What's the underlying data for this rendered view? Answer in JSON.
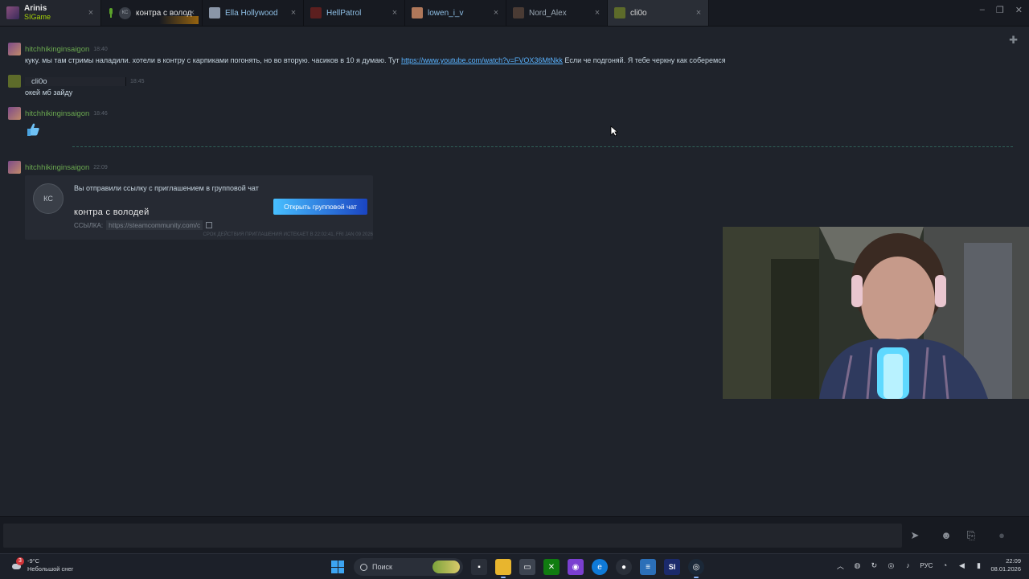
{
  "tabs": {
    "self": {
      "name": "Arinis",
      "game": "SIGame"
    },
    "items": [
      {
        "label": "контра с волод",
        "kind": "group",
        "initials": "КС"
      },
      {
        "label": "Ella Hollywood",
        "color": "#8a96a8"
      },
      {
        "label": "HellPatrol",
        "color": "#5c1f1f"
      },
      {
        "label": "lowen_i_v",
        "color": "#b0785a"
      },
      {
        "label": "Nord_Alex",
        "color": "#4a3b34"
      },
      {
        "label": "cli0o",
        "color": "#5d6b2a"
      }
    ],
    "close_glyph": "×"
  },
  "window_controls": {
    "minimize": "–",
    "maximize": "❐",
    "close": "✕"
  },
  "chat": {
    "messages": [
      {
        "author": "hitchhikinginsaigon",
        "time": "18:40",
        "text_before": "куку. мы там стримы наладили. хотели в контру с карпиками погонять, но во вторую. часиков в 10 я думаю. Тут ",
        "link": "https://www.youtube.com/watch?v=FVOX36MtNkk",
        "text_after": " Если че подгоняй. Я тебе черкну как соберемся"
      },
      {
        "author": "cli0o",
        "time": "18:45",
        "text": "окей мб зайду"
      },
      {
        "author": "hitchhikinginsaigon",
        "time": "18:46",
        "emoji": "thumbs-up"
      },
      {
        "author": "hitchhikinginsaigon",
        "time": "22:09"
      }
    ],
    "invite": {
      "initials": "КС",
      "text": "Вы отправили ссылку с приглашением в групповой чат",
      "group_name": "контра с володей",
      "link_label": "ССЫЛКА:",
      "link_value": "https://steamcommunity.com/c",
      "button": "Открыть групповой чат",
      "expires": "СРОК ДЕЙСТВИЯ ПРИГЛАШЕНИЯ ИСТЕКАЕТ В 22:02:41, FRI JAN 09 2026"
    }
  },
  "input": {
    "placeholder": "",
    "send_icon": "send-icon"
  },
  "taskbar": {
    "weather": {
      "temp": "-9°C",
      "desc": "Небольшой снег",
      "badge": "3"
    },
    "search_label": "Поиск",
    "tray": {
      "lang": "РУС",
      "time": "22:09",
      "date": "08.01.2026"
    }
  },
  "colors": {
    "accent": "#1a9fff",
    "friend_name": "#6aa84f",
    "link": "#5ab3ff"
  }
}
